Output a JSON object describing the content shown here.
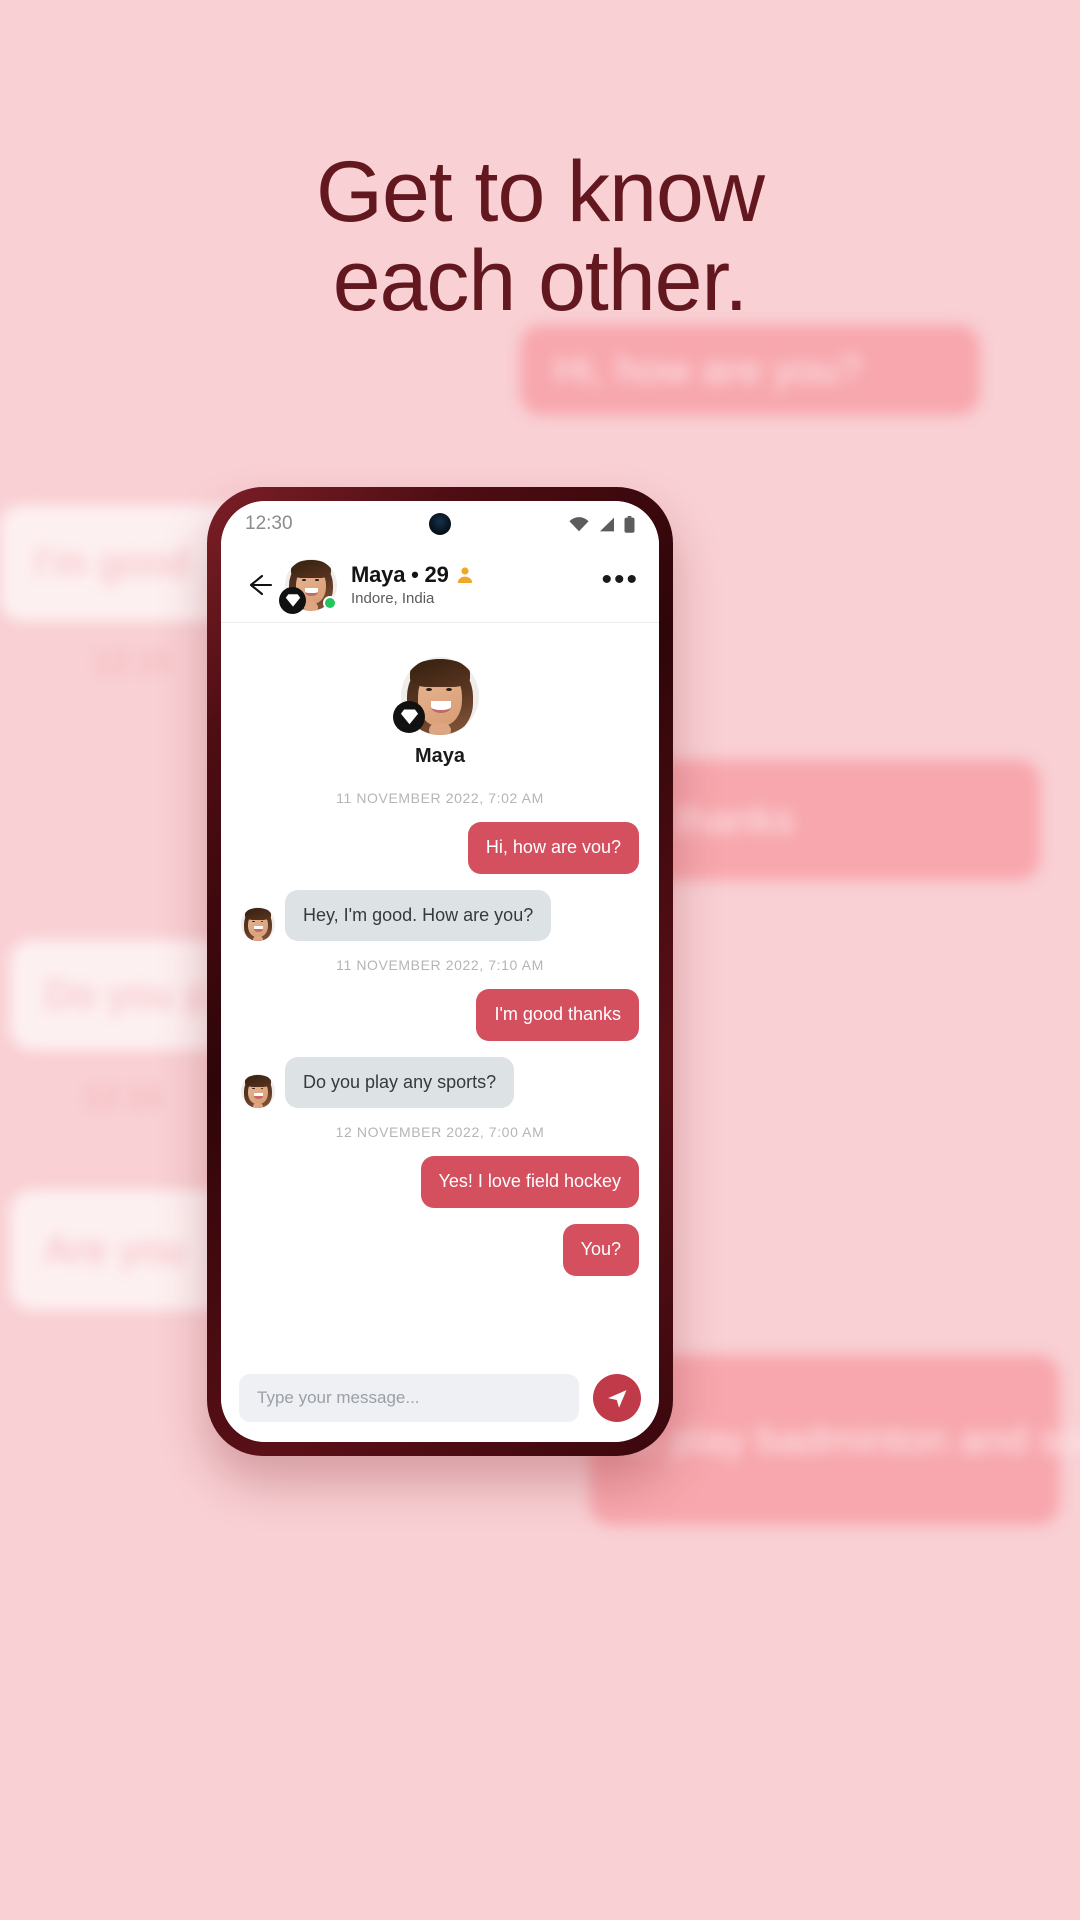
{
  "headline": {
    "line1": "Get to know",
    "line2": "each other."
  },
  "background_bubbles": [
    {
      "text": "Hi, how are you?",
      "kind": "out"
    },
    {
      "text": "I'm good",
      "kind": "in"
    },
    {
      "text": "12:15",
      "kind": "date"
    },
    {
      "text": "thanks",
      "kind": "out"
    },
    {
      "text": "Do you p",
      "kind": "in"
    },
    {
      "text": "12:16",
      "kind": "date"
    },
    {
      "text": "Are you",
      "kind": "in"
    },
    {
      "text": "to play badminton and soccer",
      "kind": "out"
    }
  ],
  "status_bar": {
    "time": "12:30",
    "wifi_icon": "wifi-icon",
    "signal_icon": "cellular-signal-icon",
    "battery_icon": "battery-icon",
    "camera_icon": "front-camera-punch-hole"
  },
  "chat_header": {
    "back_icon": "back-arrow-icon",
    "name": "Maya • 29",
    "location": "Indore, India",
    "verified_icon": "verified-person-icon",
    "premium_icon": "diamond-badge-icon",
    "online_status": "online",
    "more_label": "•••"
  },
  "profile": {
    "name": "Maya",
    "premium_icon": "diamond-badge-icon"
  },
  "conversation": [
    {
      "type": "timestamp",
      "text": "11 NOVEMBER 2022, 7:02 AM"
    },
    {
      "type": "message",
      "direction": "sent",
      "text": "Hi, how are vou?"
    },
    {
      "type": "message",
      "direction": "received",
      "text": "Hey, I'm good. How are you?"
    },
    {
      "type": "timestamp",
      "text": "11 NOVEMBER 2022, 7:10 AM"
    },
    {
      "type": "message",
      "direction": "sent",
      "text": "I'm good thanks"
    },
    {
      "type": "message",
      "direction": "received",
      "text": "Do you play any sports?"
    },
    {
      "type": "timestamp",
      "text": "12 NOVEMBER 2022, 7:00 AM"
    },
    {
      "type": "message",
      "direction": "sent",
      "text": "Yes! I love field hockey"
    },
    {
      "type": "message",
      "direction": "sent",
      "text": "You?"
    }
  ],
  "input_bar": {
    "placeholder": "Type your message...",
    "send_icon": "send-paper-plane-icon"
  },
  "colors": {
    "page_background": "#f9d0d4",
    "headline": "#631820",
    "sent_bubble": "#d4505f",
    "received_bubble": "#dde2e5",
    "send_button": "#c03a49",
    "online_dot": "#22c55e",
    "verified_icon": "#f0a72a",
    "phone_bezel": "#2e0509"
  }
}
